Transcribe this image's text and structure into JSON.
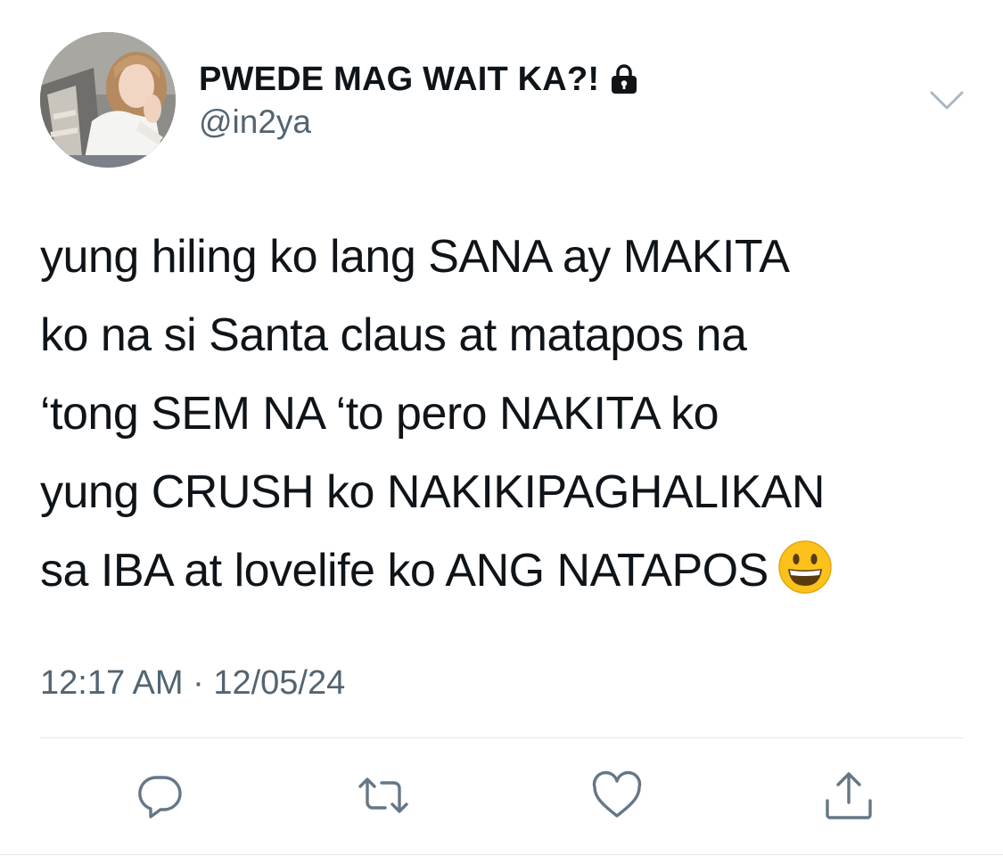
{
  "tweet": {
    "author": {
      "display_name": "PWEDE MAG WAIT KA?!",
      "handle": "@in2ya",
      "protected_icon": "lock-icon",
      "avatar": "profile-photo"
    },
    "text_lines": [
      "yung hiling ko lang SANA ay MAKITA",
      "ko na si Santa claus at matapos na",
      "‘tong SEM NA ‘to pero NAKITA ko",
      "yung CRUSH ko NAKIKIPAGHALIKAN",
      "sa IBA at lovelife ko ANG NATAPOS"
    ],
    "emoji": "grinning-face",
    "time": "12:17 AM",
    "separator": "·",
    "date": "12/05/24",
    "menu_icon": "chevron-down-icon",
    "actions": [
      {
        "name": "reply",
        "icon": "reply-icon"
      },
      {
        "name": "retweet",
        "icon": "retweet-icon"
      },
      {
        "name": "like",
        "icon": "heart-icon"
      },
      {
        "name": "share",
        "icon": "share-icon"
      }
    ]
  },
  "colors": {
    "text": "#0f1419",
    "secondary": "#536471",
    "icon": "#657786",
    "divider": "#e1e8ed",
    "emoji_face": "#fcc21b"
  }
}
